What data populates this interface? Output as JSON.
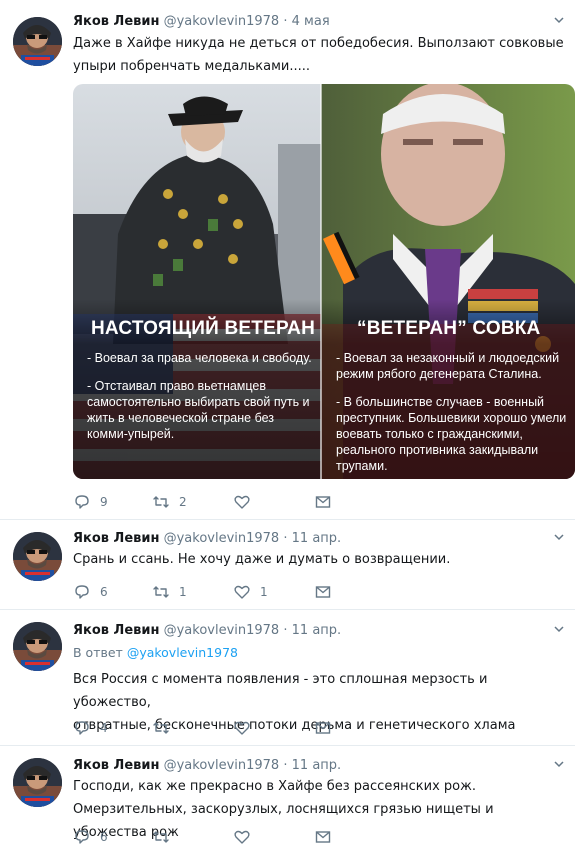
{
  "tweets": [
    {
      "name": "Яков Левин",
      "handle": "@yakovlevin1978",
      "dot": "·",
      "date": "4 мая",
      "text": [
        "Даже в Хайфе никуда не деться от победобесия. Выползают совковые",
        "упыри побренчать медальками....."
      ],
      "actions": {
        "reply": "9",
        "retweet": "2",
        "like": ""
      },
      "media": {
        "left_title": "НАСТОЯЩИЙ ВЕТЕРАН",
        "left_lines": [
          "- Воевал за права человека и свободу.",
          "",
          "- Отстаивал право вьетнамцев",
          "самостоятельно выбирать свой путь и",
          "жить в человеческой стране без",
          "комми-упырей."
        ],
        "right_title": "“ВЕТЕРАН” СОВКА",
        "right_lines": [
          "- Воевал за незаконный и людоедский",
          "режим рябого дегенерата Сталина.",
          "",
          "- В большинстве случаев - военный",
          "преступник. Большевики хорошо умели",
          "воевать только с гражданскими,",
          "реального противника закидывали",
          "трупами."
        ]
      }
    },
    {
      "name": "Яков Левин",
      "handle": "@yakovlevin1978",
      "dot": "·",
      "date": "11 апр.",
      "text": [
        "Срань и ссань. Не хочу даже и думать о возвращении."
      ],
      "actions": {
        "reply": "6",
        "retweet": "1",
        "like": "1"
      }
    },
    {
      "name": "Яков Левин",
      "handle": "@yakovlevin1978",
      "dot": "·",
      "date": "11 апр.",
      "reply_prefix": "В ответ",
      "reply_to": "@yakovlevin1978",
      "text": [
        "Вся Россия с момента появления - это сплошная мерзость и убожество,",
        "отвратные, бесконечные потоки дерьма и генетического хлама"
      ],
      "actions": {
        "reply": "4",
        "retweet": "",
        "like": ""
      }
    },
    {
      "name": "Яков Левин",
      "handle": "@yakovlevin1978",
      "dot": "·",
      "date": "11 апр.",
      "text": [
        "Господи, как же прекрасно в Хайфе без рассеянских рож.",
        "Омерзительных, заскорузлых, лоснящихся грязью нищеты и убожества рож"
      ],
      "actions": {
        "reply": "6",
        "retweet": "",
        "like": ""
      }
    }
  ],
  "icons": [
    "avatar",
    "chevron-down-icon",
    "reply-icon",
    "retweet-icon",
    "like-icon",
    "message-icon"
  ],
  "colors": {
    "text": "#14171a",
    "secondary": "#657786",
    "link": "#1da1f2",
    "divider": "#e6ecf0"
  }
}
